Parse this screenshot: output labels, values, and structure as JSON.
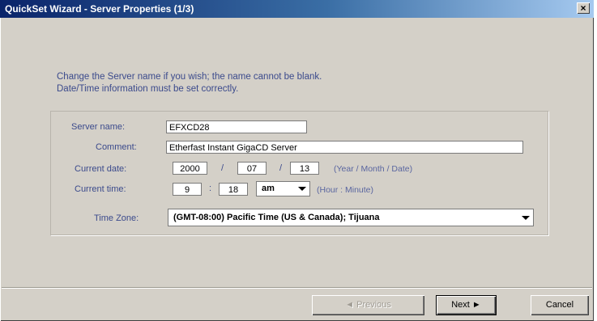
{
  "window": {
    "title": "QuickSet Wizard - Server Properties (1/3)",
    "close_glyph": "×"
  },
  "instructions": {
    "line1": "Change the Server name if you wish; the name cannot be blank.",
    "line2": "Date/Time information must be set correctly."
  },
  "form": {
    "server_name": {
      "label": "Server name:",
      "value": "EFXCD28"
    },
    "comment": {
      "label": "Comment:",
      "value": "Etherfast Instant GigaCD Server"
    },
    "current_date": {
      "label": "Current date:",
      "year": "2000",
      "month": "07",
      "day": "13",
      "separator": "/",
      "hint": "(Year / Month / Date)"
    },
    "current_time": {
      "label": "Current time:",
      "hour": "9",
      "minute": "18",
      "separator": ":",
      "ampm": "am",
      "hint": "(Hour : Minute)"
    },
    "time_zone": {
      "label": "Time Zone:",
      "value": "(GMT-08:00) Pacific Time (US & Canada); Tijuana"
    }
  },
  "buttons": {
    "previous": "◄ Previous",
    "next": "Next ►",
    "cancel": "Cancel"
  },
  "colors": {
    "title_bar": "#0a246a",
    "label_text": "#3b4a8c",
    "dialog_face": "#d4d0c8"
  }
}
